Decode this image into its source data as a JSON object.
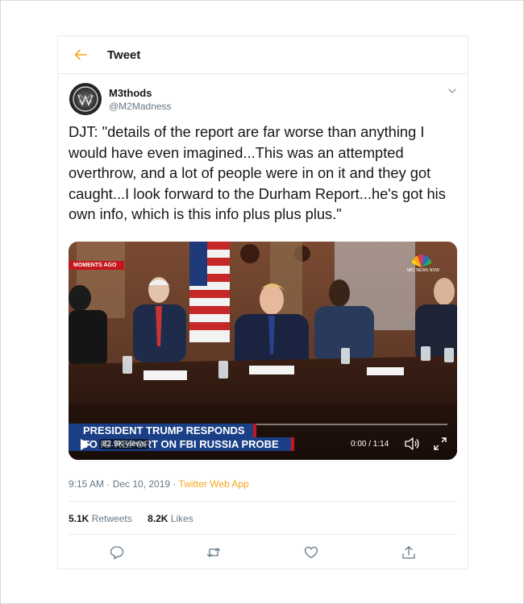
{
  "header": {
    "title": "Tweet",
    "back_icon": "arrow-left-icon"
  },
  "author": {
    "display_name": "M3thods",
    "handle": "@M2Madness",
    "avatar_icon": "m3-logo-avatar"
  },
  "tweet": {
    "text": "DJT: \"details of the report are far worse than anything I would have even imagined...This was an attempted overthrow, and a lot of people were in on it and they got caught...I look forward to the Durham Report...he's got his own info, which is this info plus plus plus.\""
  },
  "video": {
    "badge": "MOMENTS AGO",
    "network": "NBC NEWS NOW",
    "chyron_line1": "PRESIDENT TRUMP RESPONDS",
    "chyron_line2": "TO IG REPORT ON FBI RUSSIA PROBE",
    "views": "82.9K views",
    "time": "0:00 / 1:14",
    "progress": 0
  },
  "meta": {
    "timestamp": "9:15 AM · Dec 10, 2019 · ",
    "source": "Twitter Web App"
  },
  "stats": {
    "retweets_count": "5.1K",
    "retweets_label": "Retweets",
    "likes_count": "8.2K",
    "likes_label": "Likes"
  },
  "colors": {
    "accent": "#f5a623",
    "text": "#14171a",
    "muted": "#657786",
    "chyron_blue": "#1a3f86",
    "badge_red": "#c4161c"
  }
}
